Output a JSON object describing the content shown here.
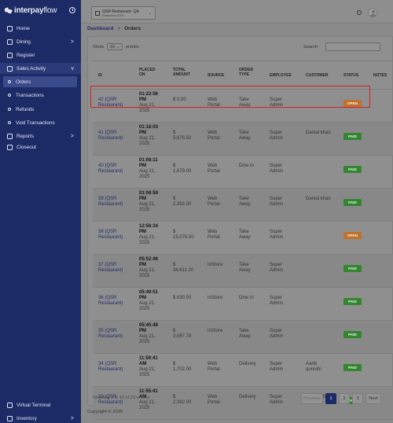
{
  "brand": {
    "name_bold": "interpay",
    "name_thin": "flow"
  },
  "sidebar": {
    "items": [
      {
        "label": "Home",
        "icon": "home-icon"
      },
      {
        "label": "Dining",
        "icon": "dining-icon",
        "chevron": ">"
      },
      {
        "label": "Register",
        "icon": "register-icon"
      },
      {
        "label": "Sales Activity",
        "icon": "sales-icon",
        "chevron": "v"
      },
      {
        "label": "Orders"
      },
      {
        "label": "Transactions"
      },
      {
        "label": "Refunds"
      },
      {
        "label": "Void Transactions"
      },
      {
        "label": "Reports",
        "icon": "reports-icon",
        "chevron": ">"
      },
      {
        "label": "Closeout",
        "icon": "closeout-icon"
      }
    ],
    "bottom": [
      {
        "label": "Virtual Terminal",
        "icon": "terminal-icon"
      },
      {
        "label": "Inventory",
        "icon": "inventory-icon",
        "chevron": ">"
      }
    ]
  },
  "topbar": {
    "store_name": "QSR Restaurant- QA",
    "store_sub": "Restaurant, 0000",
    "chevron": "⌄"
  },
  "breadcrumb": {
    "root": "Dashboard",
    "sep": ">",
    "current": "Orders"
  },
  "controls": {
    "show": "Show",
    "page_len": "10",
    "entries": "entries",
    "search_label": "Search:"
  },
  "table": {
    "headers": [
      "ID",
      "PLACED ON",
      "TOTAL AMOUNT",
      "SOURCE",
      "ORDER TYPE",
      "EMPLOYEE",
      "CUSTOMER",
      "STATUS",
      "NOTES"
    ],
    "rows": [
      {
        "id": "42 (QSR Restaurant)",
        "time": "01:22:56 PM",
        "date": "Aug 21, 2025",
        "amount": "$ 0.00",
        "source": "Web Portal",
        "type": "Take Away",
        "employee": "Super Admin",
        "customer": "",
        "status": "OPEN"
      },
      {
        "id": "41 (QSR Restaurant)",
        "time": "01:18:03 PM",
        "date": "Aug 21, 2025",
        "amount": "$ 5,876.50",
        "source": "Web Portal",
        "type": "Take Away",
        "employee": "Super Admin",
        "customer": "Danial khan",
        "status": "PAID"
      },
      {
        "id": "40 (QSR Restaurant)",
        "time": "01:08:11 PM",
        "date": "Aug 21, 2025",
        "amount": "$ 1,679.00",
        "source": "Web Portal",
        "type": "Dine In",
        "employee": "Super Admin",
        "customer": "",
        "status": "PAID"
      },
      {
        "id": "39 (QSR Restaurant)",
        "time": "01:06:59 PM",
        "date": "Aug 21, 2025",
        "amount": "$ 2,392.00",
        "source": "Web Portal",
        "type": "Take Away",
        "employee": "Super Admin",
        "customer": "Danial khan",
        "status": "PAID"
      },
      {
        "id": "38 (QSR Restaurant)",
        "time": "12:56:34 PM",
        "date": "Aug 21, 2025",
        "amount": "$ 15,076.50",
        "source": "Web Portal",
        "type": "Take Away",
        "employee": "Super Admin",
        "customer": "",
        "status": "OPEN"
      },
      {
        "id": "37 (QSR Restaurant)",
        "time": "05:52:46 PM",
        "date": "Aug 21, 2025",
        "amount": "$ 34,611.20",
        "source": "InStore",
        "type": "Take Away",
        "employee": "Super Admin",
        "customer": "",
        "status": "PAID"
      },
      {
        "id": "36 (QSR Restaurant)",
        "time": "05:49:51 PM",
        "date": "Aug 21, 2025",
        "amount": "$ 830.00",
        "source": "InStore",
        "type": "Dine In",
        "employee": "Super Admin",
        "customer": "",
        "status": "PAID"
      },
      {
        "id": "35 (QSR Restaurant)",
        "time": "05:45:48 PM",
        "date": "Aug 21, 2025",
        "amount": "$ 3,067.78",
        "source": "InStore",
        "type": "Take Away",
        "employee": "Super Admin",
        "customer": "",
        "status": "PAID"
      },
      {
        "id": "34 (QSR Restaurant)",
        "time": "11:59:41 AM",
        "date": "Aug 21, 2025",
        "amount": "$ 1,702.00",
        "source": "Web Portal",
        "type": "Delivery",
        "employee": "Super Admin",
        "customer": "Aarib qureshi",
        "status": "PAID"
      },
      {
        "id": "33 (QSR Restaurant)",
        "time": "11:55:41 AM",
        "date": "Aug 21, 2025",
        "amount": "$ 2,392.00",
        "source": "Web Portal",
        "type": "Delivery",
        "employee": "Super Admin",
        "customer": "Danial khan",
        "status": "PAID"
      }
    ]
  },
  "footer": {
    "showing": "Showing 1 to 10 of 23 entries",
    "prev": "Previous",
    "pages": [
      "1",
      "2",
      "3"
    ],
    "next": "Next",
    "copyright": "Copyright © 2025"
  },
  "colors": {
    "sidebar": "#1c2a66",
    "paid": "#33852f",
    "open": "#c0722a",
    "highlight": "#d52020"
  }
}
